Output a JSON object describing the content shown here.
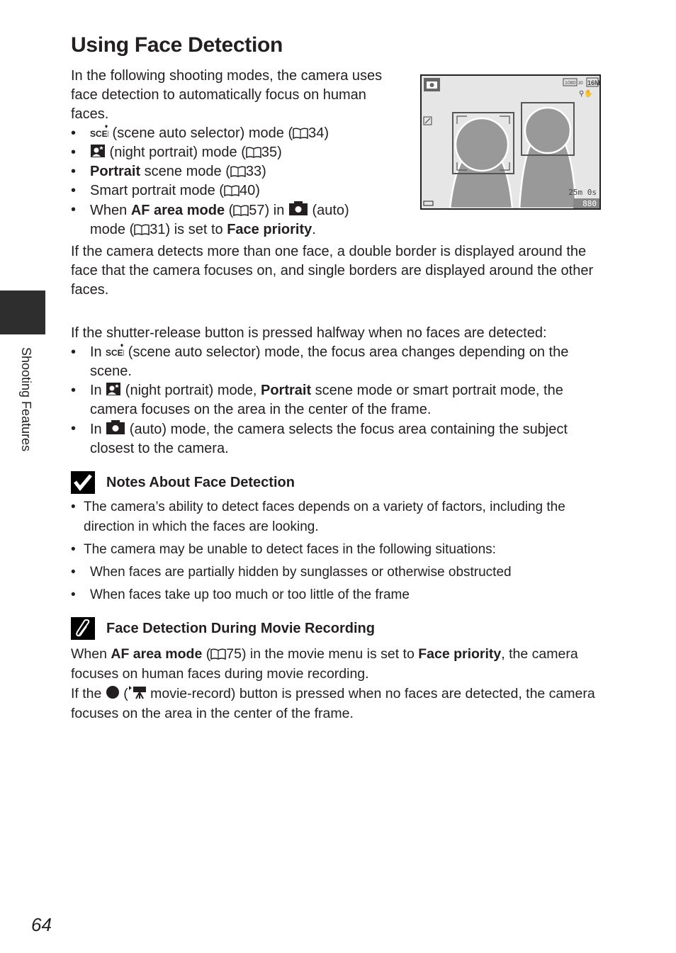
{
  "title": "Using Face Detection",
  "intro": "In the following shooting modes, the camera uses face detection to automatically focus on human faces.",
  "modes_list": [
    {
      "icon": "scene-auto-selector-icon",
      "text": " (scene auto selector) mode (",
      "ref": "34",
      "close": ")"
    },
    {
      "icon": "night-portrait-icon",
      "text": " (night portrait) mode (",
      "ref": "35",
      "close": ")"
    },
    {
      "bold": "Portrait",
      "text": " scene mode (",
      "ref": "33",
      "close": ")"
    },
    {
      "text": "Smart portrait mode (",
      "ref": "40",
      "close": ")"
    },
    {
      "pre": "When ",
      "bold": "AF area mode",
      "mid": " (",
      "ref": "57",
      "after_ref": ") in ",
      "icon": "auto-camera-icon",
      "post": " (auto) mode (",
      "ref2": "31",
      "post2": ") is set to ",
      "bold2": "Face priority",
      "end": "."
    }
  ],
  "double_border_para": "If the camera detects more than one face, a double border is displayed around the face that the camera focuses on, and single borders are displayed around the other faces.",
  "halfway_intro": "If the shutter-release button is pressed halfway when no faces are detected:",
  "halfway_list": [
    {
      "pre": "In ",
      "icon": "scene-auto-selector-icon",
      "text": " (scene auto selector) mode, the focus area changes depending on the scene."
    },
    {
      "pre": "In ",
      "icon": "night-portrait-icon",
      "text": " (night portrait) mode, ",
      "bold": "Portrait",
      "post": " scene mode or smart portrait mode, the camera focuses on the area in the center of the frame."
    },
    {
      "pre": "In ",
      "icon": "auto-camera-icon",
      "text": " (auto) mode, the camera selects the focus area containing the subject closest to the camera."
    }
  ],
  "notes": {
    "heading": "Notes About Face Detection",
    "items": [
      "The camera’s ability to detect faces depends on a variety of factors, including the direction in which the faces are looking.",
      "The camera may be unable to detect faces in the following situations:"
    ],
    "sub_items": [
      "When faces are partially hidden by sunglasses or otherwise obstructed",
      "When faces take up too much or too little of the frame"
    ]
  },
  "movie": {
    "heading": "Face Detection During Movie Recording",
    "p1_pre": "When ",
    "p1_bold": "AF area mode",
    "p1_mid": " (",
    "p1_ref": "75",
    "p1_post": ") in the movie menu is set to ",
    "p1_bold2": "Face priority",
    "p1_end": ", the camera focuses on human faces during movie recording.",
    "p2_pre": "If the ",
    "p2_mid": " (",
    "p2_post": " movie-record) button is pressed when no faces are detected, the camera focuses on the area in the center of the frame."
  },
  "screen": {
    "movie_size": "1080",
    "frame_rate": "30",
    "image_size": "16M",
    "remaining_time": "25m 0s",
    "exposures": "880"
  },
  "side_tab": "Shooting Features",
  "page_number": "64"
}
